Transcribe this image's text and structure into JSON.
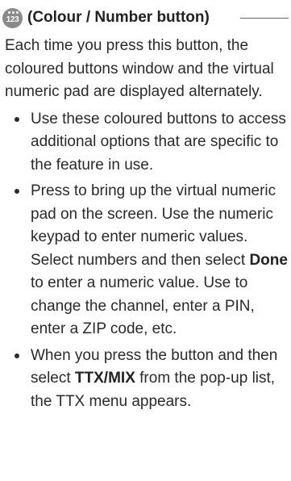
{
  "heading": {
    "icon": "colour-number-button-icon",
    "icon_label": "123",
    "title": "(Colour / Number button)"
  },
  "intro": "Each time you press this button, the coloured buttons window and the virtual numeric pad are displayed alternately.",
  "bullets": {
    "b1": {
      "text": "Use these coloured buttons to access additional options that are specific to the feature in use."
    },
    "b2": {
      "part1": "Press to bring up the virtual numeric pad on the screen. Use the numeric keypad to enter numeric values. Select numbers and then select ",
      "strong": "Done",
      "part2": " to enter a numeric value. Use to change the channel, enter a PIN, enter a ZIP code, etc."
    },
    "b3": {
      "part1": "When you press the button and then select ",
      "strong": "TTX/MIX",
      "part2": " from the pop-up list, the TTX menu appears."
    }
  }
}
